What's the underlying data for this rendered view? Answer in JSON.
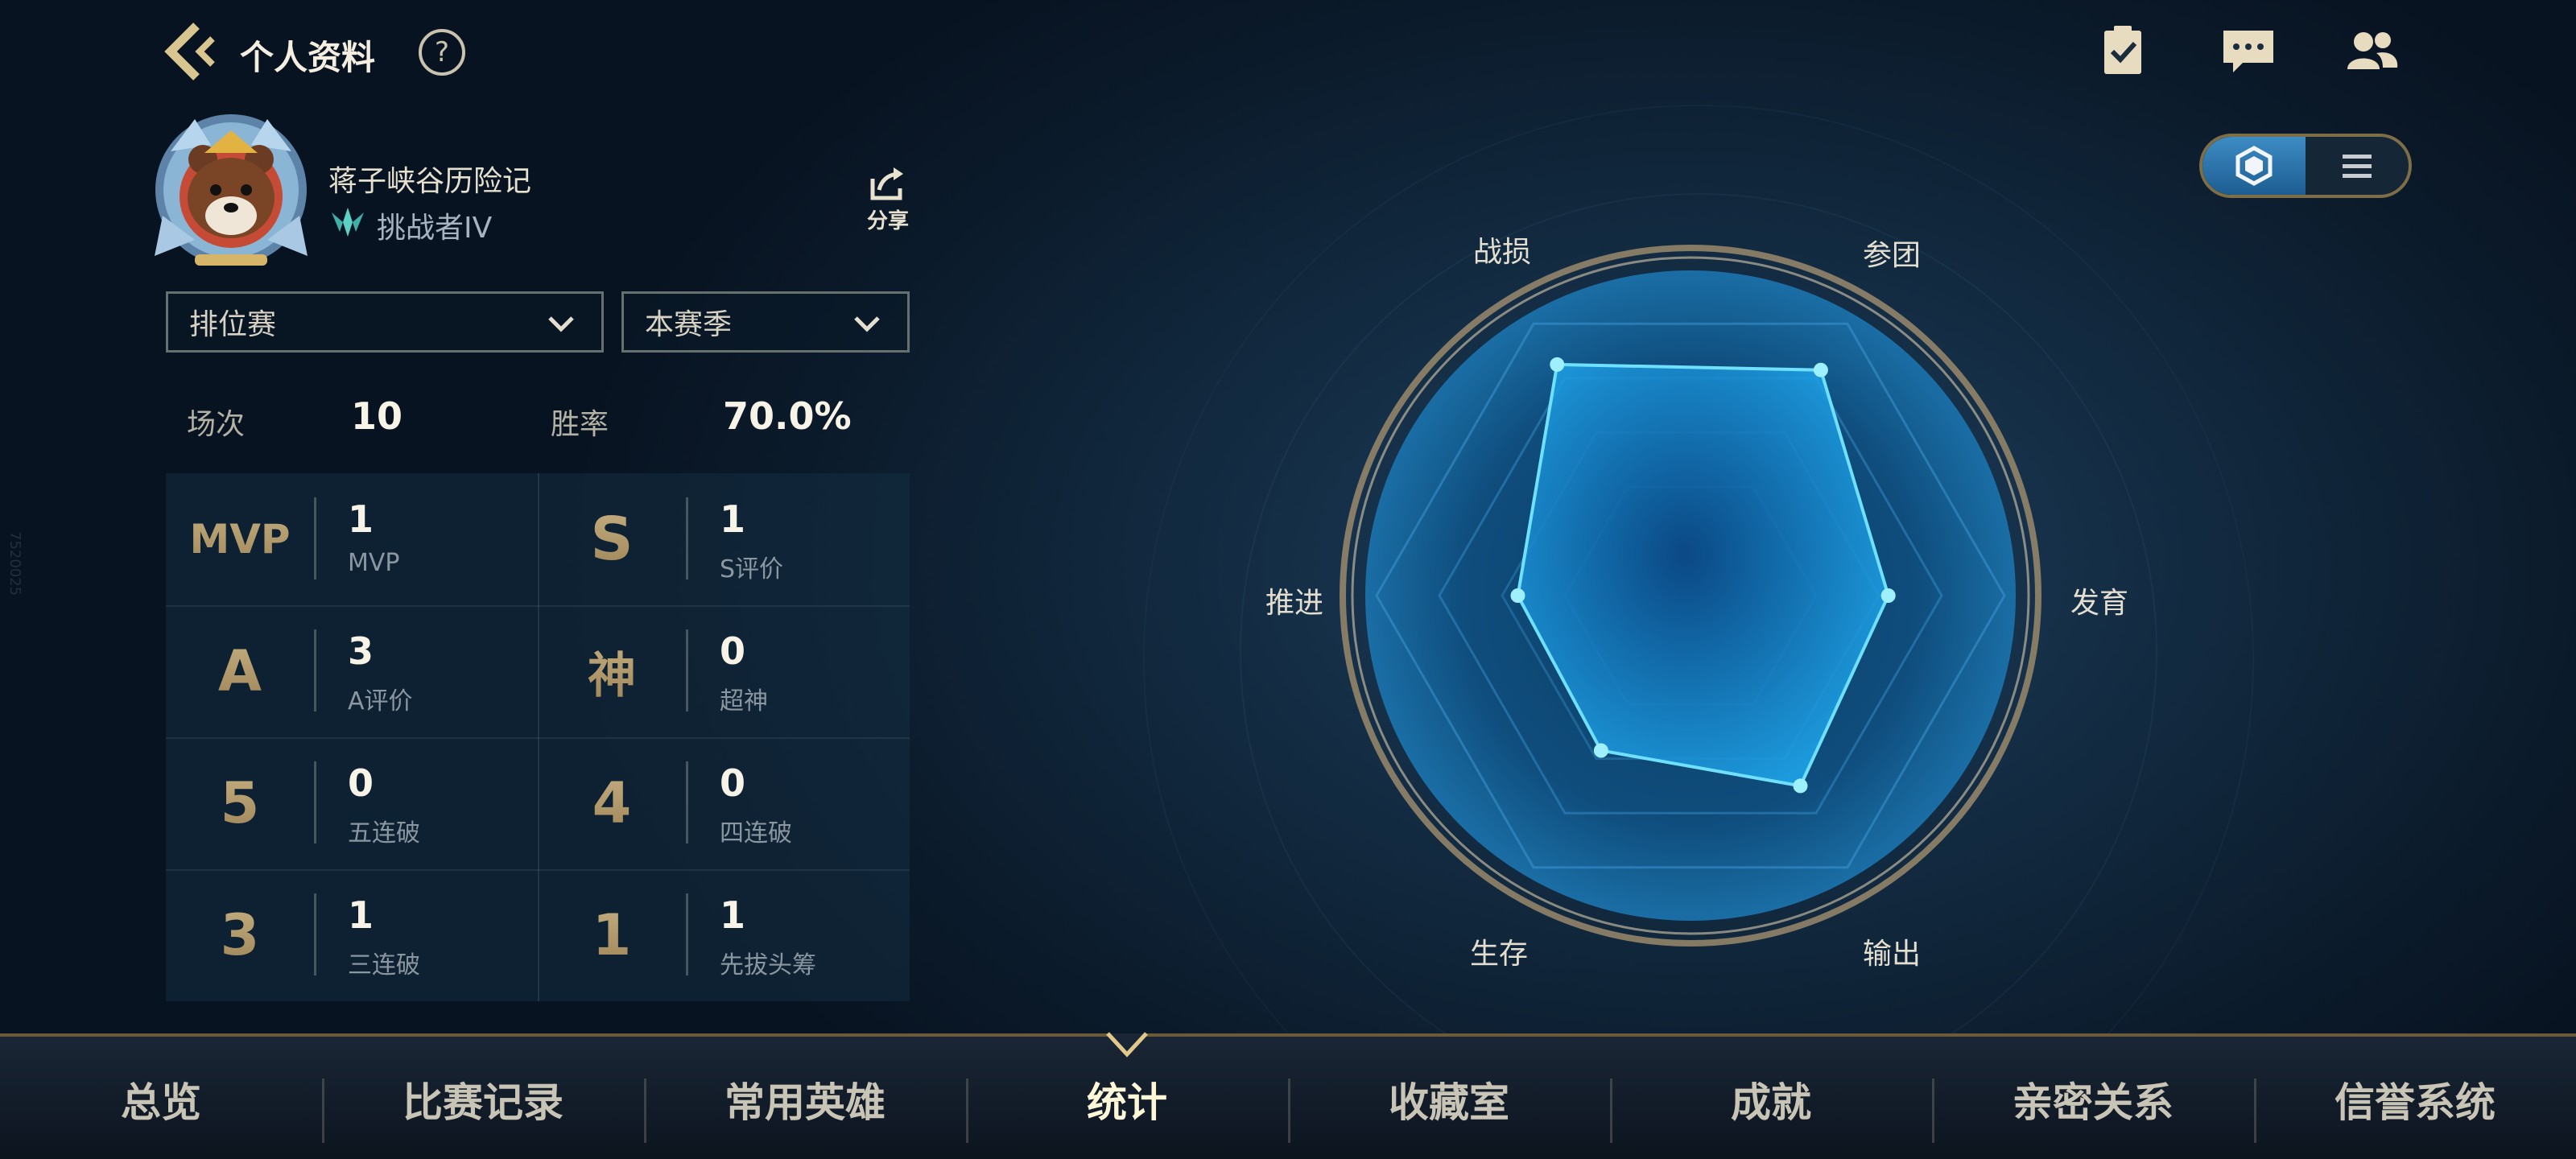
{
  "header": {
    "title": "个人资料",
    "help_label": "?"
  },
  "profile": {
    "name": "蒋子峡谷历险记",
    "rank": "挑战者IV",
    "share_label": "分享"
  },
  "filters": {
    "mode": "排位赛",
    "season": "本赛季"
  },
  "summary": {
    "matches_label": "场次",
    "matches_value": "10",
    "winrate_label": "胜率",
    "winrate_value": "70.0%"
  },
  "stats": [
    {
      "symbol": "MVP",
      "value": "1",
      "label": "MVP"
    },
    {
      "symbol": "S",
      "value": "1",
      "label": "S评价"
    },
    {
      "symbol": "A",
      "value": "3",
      "label": "A评价"
    },
    {
      "symbol": "神",
      "value": "0",
      "label": "超神"
    },
    {
      "symbol": "5",
      "value": "0",
      "label": "五连破"
    },
    {
      "symbol": "4",
      "value": "0",
      "label": "四连破"
    },
    {
      "symbol": "3",
      "value": "1",
      "label": "三连破"
    },
    {
      "symbol": "1",
      "value": "1",
      "label": "先拔头筹"
    }
  ],
  "radar": {
    "labels": [
      "战损",
      "参团",
      "发育",
      "输出",
      "生存",
      "推进"
    ],
    "values": [
      0.85,
      0.83,
      0.63,
      0.7,
      0.57,
      0.55
    ]
  },
  "nav": {
    "tabs": [
      "总览",
      "比赛记录",
      "常用英雄",
      "统计",
      "收藏室",
      "成就",
      "亲密关系",
      "信誉系统"
    ],
    "active": "统计"
  },
  "watermark": "7520025",
  "colors": {
    "accent_gold": "#c9a86a",
    "radar_fill": "#1e8fd6",
    "radar_stroke": "#5fd7ff"
  }
}
